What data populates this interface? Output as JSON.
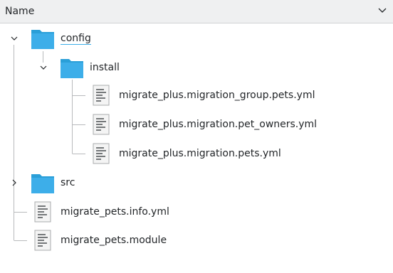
{
  "header": {
    "column_label": "Name",
    "chevron_icon": "chevron-down-icon"
  },
  "tree": {
    "config": {
      "label": "config",
      "icon": "folder-icon",
      "expanded": true,
      "selected": true
    },
    "install": {
      "label": "install",
      "icon": "folder-icon",
      "expanded": true
    },
    "file_group_pets": {
      "label": "migrate_plus.migration_group.pets.yml",
      "icon": "text-file-icon"
    },
    "file_pet_owners": {
      "label": "migrate_plus.migration.pet_owners.yml",
      "icon": "text-file-icon"
    },
    "file_pets": {
      "label": "migrate_plus.migration.pets.yml",
      "icon": "text-file-icon"
    },
    "src": {
      "label": "src",
      "icon": "folder-icon",
      "expanded": false
    },
    "info_yml": {
      "label": "migrate_pets.info.yml",
      "icon": "text-file-icon"
    },
    "module": {
      "label": "migrate_pets.module",
      "icon": "text-file-icon"
    }
  },
  "colors": {
    "folder": "#3daee9",
    "folder_dark": "#2a9fd8",
    "accent_underline": "#3daee9",
    "tree_line": "#b8babc",
    "header_bg": "#eff0f1"
  }
}
